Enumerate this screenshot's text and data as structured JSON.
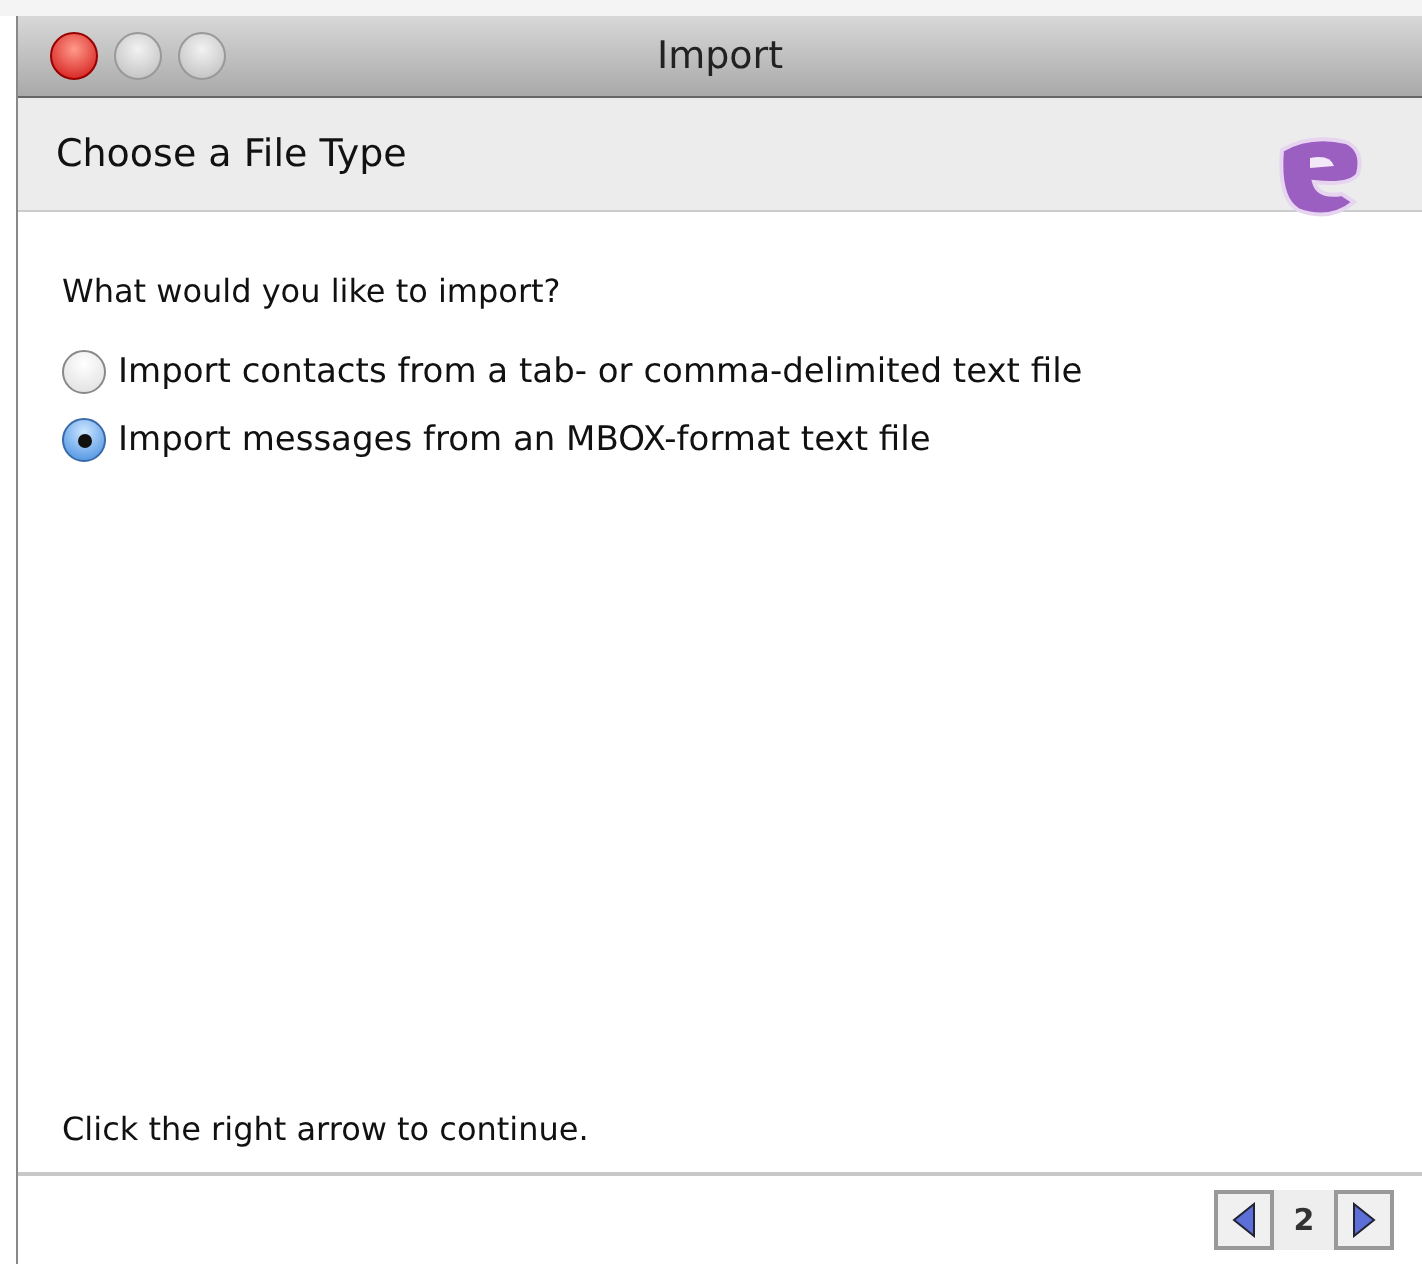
{
  "window": {
    "title": "Import"
  },
  "header": {
    "title": "Choose a File Type"
  },
  "prompt": "What would you like to import?",
  "options": [
    {
      "label": "Import contacts from a tab- or comma-delimited text file",
      "selected": false
    },
    {
      "label": "Import messages from an MBOX-format text file",
      "selected": true
    }
  ],
  "hint": "Click the right arrow to continue.",
  "pager": {
    "page": "2"
  }
}
